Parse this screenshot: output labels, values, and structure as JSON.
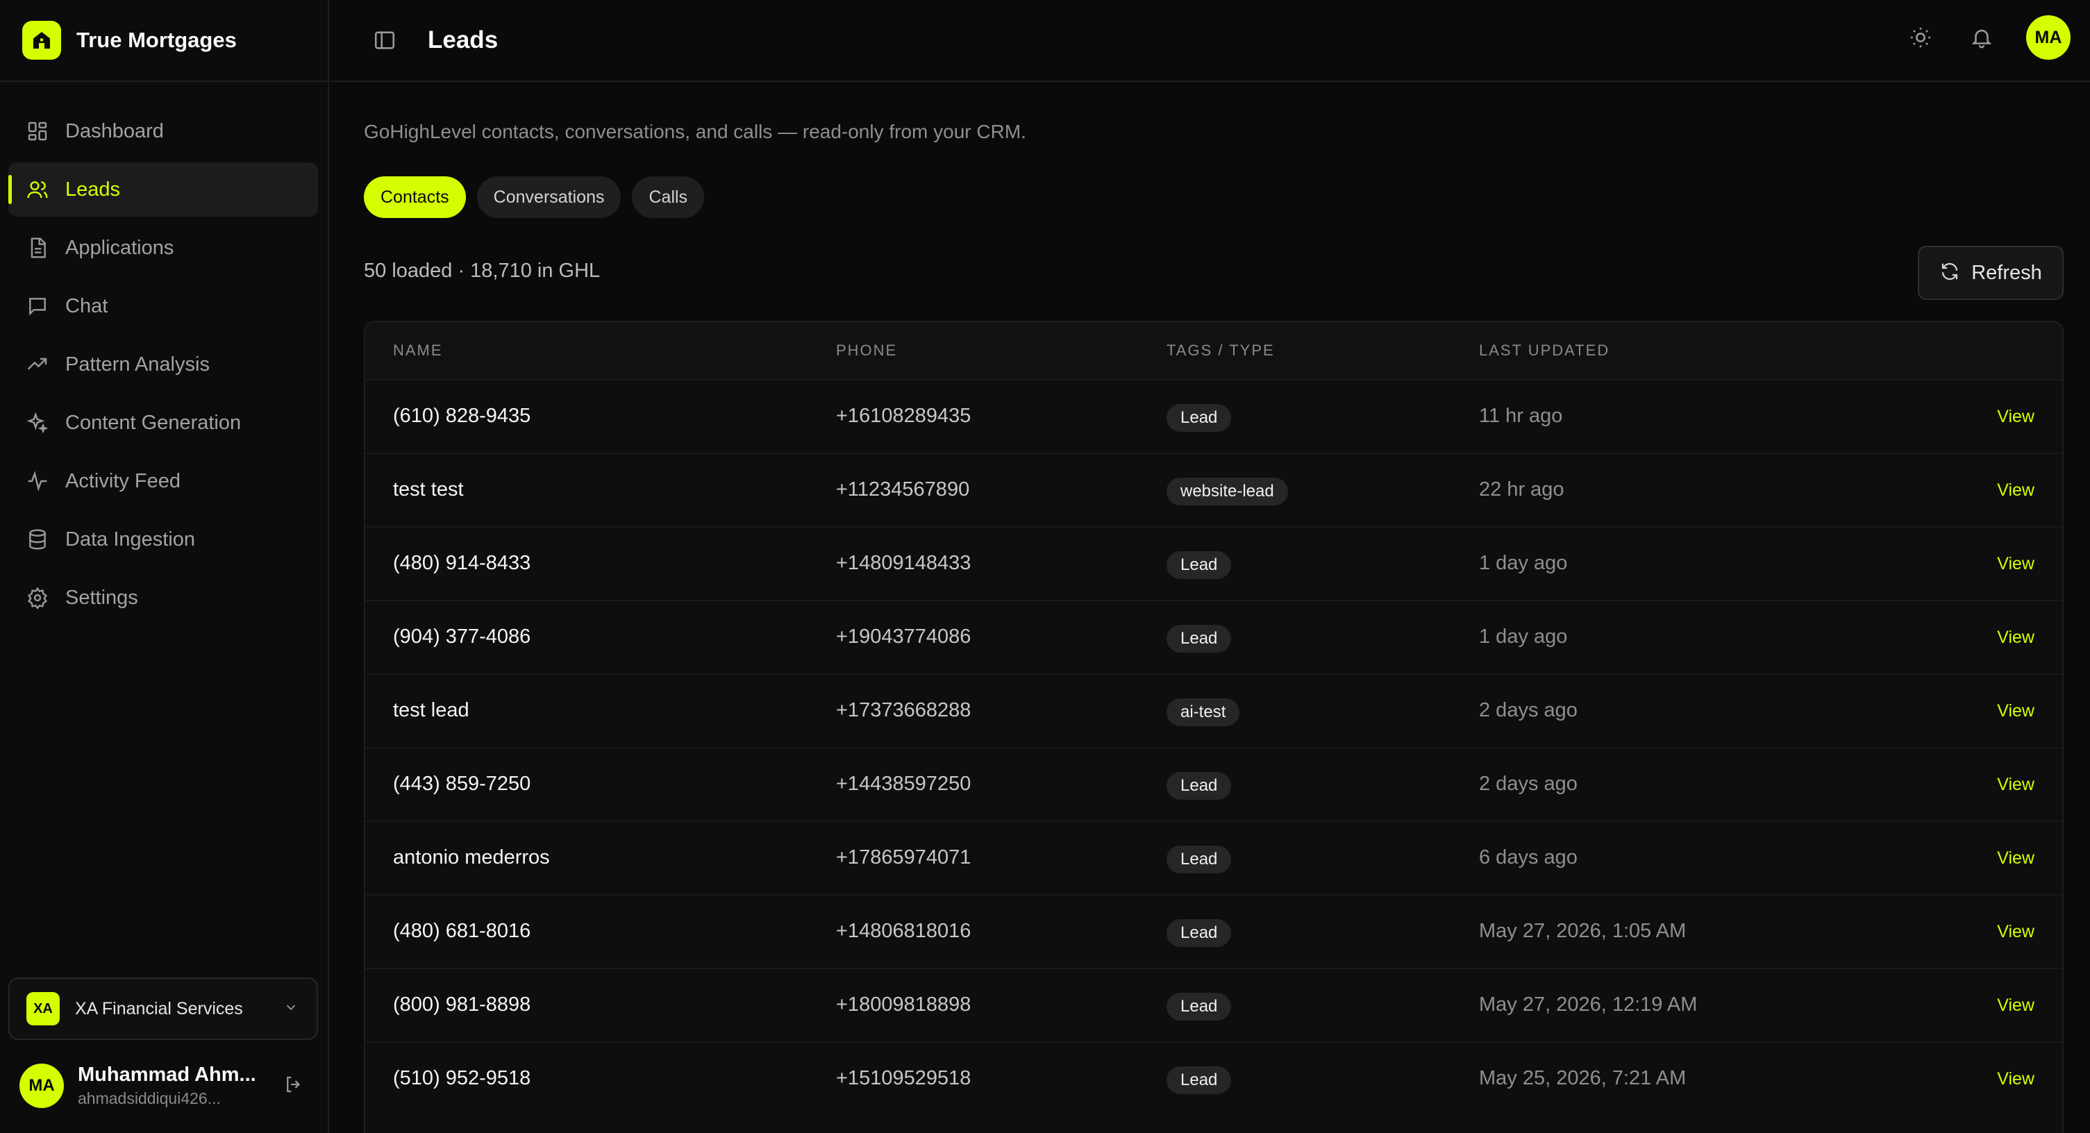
{
  "brand": {
    "name": "True Mortgages",
    "logo_icon": "house-icon",
    "accent": "#d4ff00"
  },
  "sidebar": {
    "items": [
      {
        "label": "Dashboard",
        "icon": "dashboard-grid-icon",
        "active": false
      },
      {
        "label": "Leads",
        "icon": "users-icon",
        "active": true
      },
      {
        "label": "Applications",
        "icon": "document-icon",
        "active": false
      },
      {
        "label": "Chat",
        "icon": "chat-bubble-icon",
        "active": false
      },
      {
        "label": "Pattern Analysis",
        "icon": "trending-up-icon",
        "active": false
      },
      {
        "label": "Content Generation",
        "icon": "sparkles-icon",
        "active": false
      },
      {
        "label": "Activity Feed",
        "icon": "activity-pulse-icon",
        "active": false
      },
      {
        "label": "Data Ingestion",
        "icon": "database-icon",
        "active": false
      },
      {
        "label": "Settings",
        "icon": "gear-icon",
        "active": false
      }
    ],
    "org": {
      "initials": "XA",
      "name": "XA Financial Services"
    },
    "user": {
      "initials": "MA",
      "name": "Muhammad Ahm...",
      "email": "ahmadsiddiqui426..."
    }
  },
  "header": {
    "title": "Leads",
    "avatar_initials": "MA"
  },
  "main": {
    "subtitle": "GoHighLevel contacts, conversations, and calls — read-only from your CRM.",
    "tabs": [
      {
        "label": "Contacts",
        "active": true
      },
      {
        "label": "Conversations",
        "active": false
      },
      {
        "label": "Calls",
        "active": false
      }
    ],
    "count_text": "50 loaded · 18,710 in GHL",
    "refresh_label": "Refresh"
  },
  "table": {
    "columns": [
      "NAME",
      "PHONE",
      "TAGS / TYPE",
      "LAST UPDATED"
    ],
    "action_label": "View",
    "rows": [
      {
        "name": "(610) 828-9435",
        "phone": "+16108289435",
        "tag": "Lead",
        "updated": "11 hr ago"
      },
      {
        "name": "test test",
        "phone": "+11234567890",
        "tag": "website-lead",
        "updated": "22 hr ago"
      },
      {
        "name": "(480) 914-8433",
        "phone": "+14809148433",
        "tag": "Lead",
        "updated": "1 day ago"
      },
      {
        "name": "(904) 377-4086",
        "phone": "+19043774086",
        "tag": "Lead",
        "updated": "1 day ago"
      },
      {
        "name": "test lead",
        "phone": "+17373668288",
        "tag": "ai-test",
        "updated": "2 days ago"
      },
      {
        "name": "(443) 859-7250",
        "phone": "+14438597250",
        "tag": "Lead",
        "updated": "2 days ago"
      },
      {
        "name": "antonio mederros",
        "phone": "+17865974071",
        "tag": "Lead",
        "updated": "6 days ago"
      },
      {
        "name": "(480) 681-8016",
        "phone": "+14806818016",
        "tag": "Lead",
        "updated": "May 27, 2026, 1:05 AM"
      },
      {
        "name": "(800) 981-8898",
        "phone": "+18009818898",
        "tag": "Lead",
        "updated": "May 27, 2026, 12:19 AM"
      },
      {
        "name": "(510) 952-9518",
        "phone": "+15109529518",
        "tag": "Lead",
        "updated": "May 25, 2026, 7:21 AM"
      }
    ]
  }
}
